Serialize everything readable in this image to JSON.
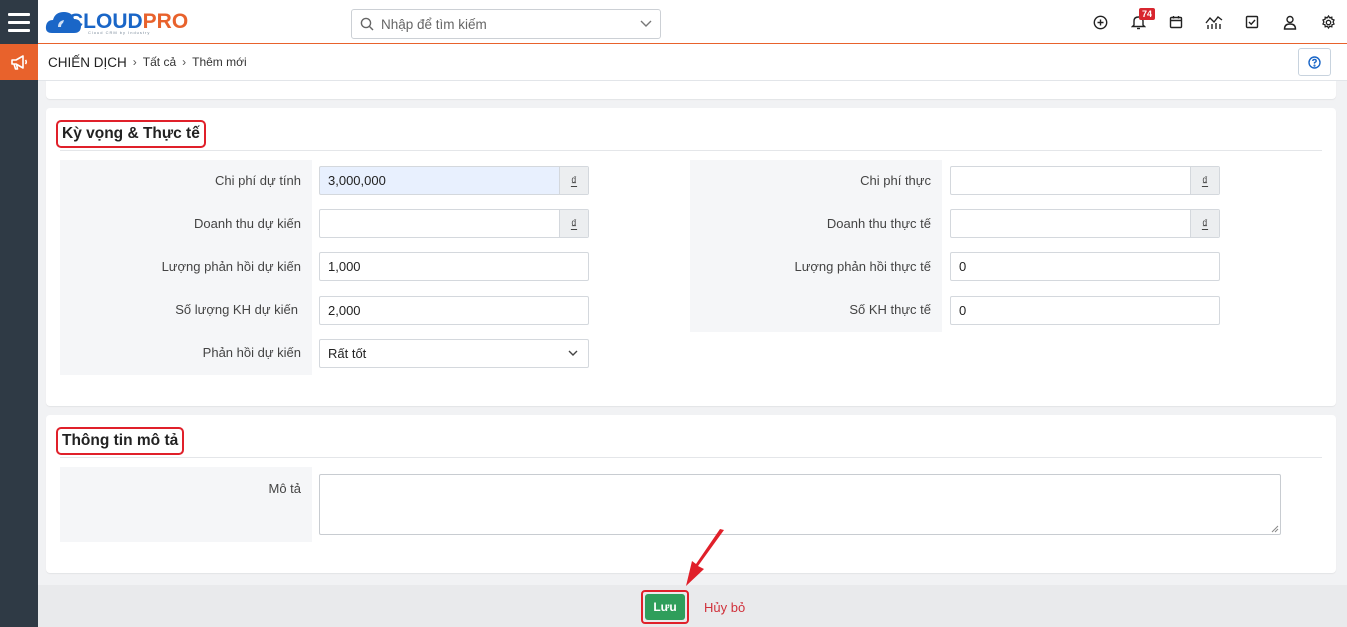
{
  "header": {
    "logo_main": "CLOUD",
    "logo_pro": "PRO",
    "logo_sub": "Cloud CRM by Industry",
    "search_placeholder": "Nhập để tìm kiếm",
    "notification_count": "74"
  },
  "breadcrumb": {
    "module": "CHIẾN DỊCH",
    "items": [
      "Tất cả",
      "Thêm mới"
    ]
  },
  "section1": {
    "title": "Kỳ vọng & Thực tế",
    "left": [
      {
        "label": "Chi phí dự tính",
        "value": "3,000,000",
        "addon": "₫"
      },
      {
        "label": "Doanh thu dự kiến",
        "value": "",
        "addon": "₫"
      },
      {
        "label": "Lượng phản hồi dự kiến",
        "value": "1,000"
      },
      {
        "label": "Số lượng KH dự kiến",
        "value": "2,000"
      },
      {
        "label": "Phản hồi dự kiến",
        "value": "Rất tốt"
      }
    ],
    "right": [
      {
        "label": "Chi phí thực",
        "value": "",
        "addon": "₫"
      },
      {
        "label": "Doanh thu thực tế",
        "value": "",
        "addon": "₫"
      },
      {
        "label": "Lượng phản hồi thực tế",
        "value": "0"
      },
      {
        "label": "Số KH thực tế",
        "value": "0"
      }
    ]
  },
  "section2": {
    "title": "Thông tin mô tả",
    "description_label": "Mô tả",
    "description_value": ""
  },
  "footer": {
    "save_label": "Lưu",
    "cancel_label": "Hủy bỏ"
  },
  "colors": {
    "accent": "#e8622c",
    "highlight": "#e0202a",
    "save": "#2f9e5b",
    "sidebar": "#2f3a45"
  }
}
